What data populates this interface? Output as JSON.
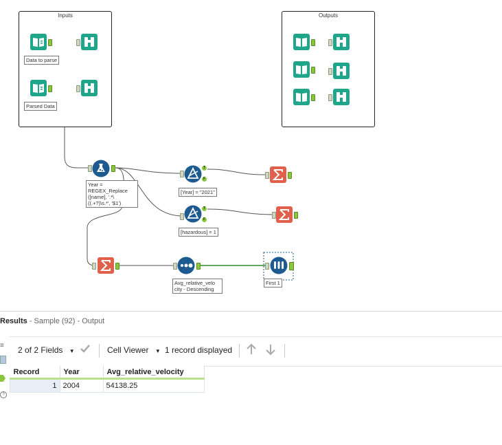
{
  "containers": {
    "inputs_title": "Inputs",
    "outputs_title": "Outputs"
  },
  "tools": {
    "input1_label": "Data to parse",
    "input2_label": "Parsed Data",
    "formula_label": "Year =\nREGEX_Replace\n([name], '.*\\((.+?)\\s.*', '$1')",
    "filter1_label": "[Year] = \"2021\"",
    "filter2_label": "[hazardous] = 1",
    "sort_label": "Avg_relative_velo\ncity - Descending",
    "sample_label": "First 1",
    "filter_true": "T",
    "filter_false": "F"
  },
  "results": {
    "title": "Results",
    "subtitle": "- Sample (92) - Output",
    "fields_label": "2 of 2 Fields",
    "viewer_label": "Cell Viewer",
    "records_label": "1 record displayed",
    "columns": [
      "Record",
      "Year",
      "Avg_relative_velocity"
    ],
    "rows": [
      {
        "record": "1",
        "year": "2004",
        "velocity": "54138.25"
      }
    ]
  },
  "colors": {
    "tool_teal": "#1fa58a",
    "tool_blue": "#1d5a8f",
    "summarize_red": "#e0604b",
    "anchor_green": "#8cc63f"
  }
}
